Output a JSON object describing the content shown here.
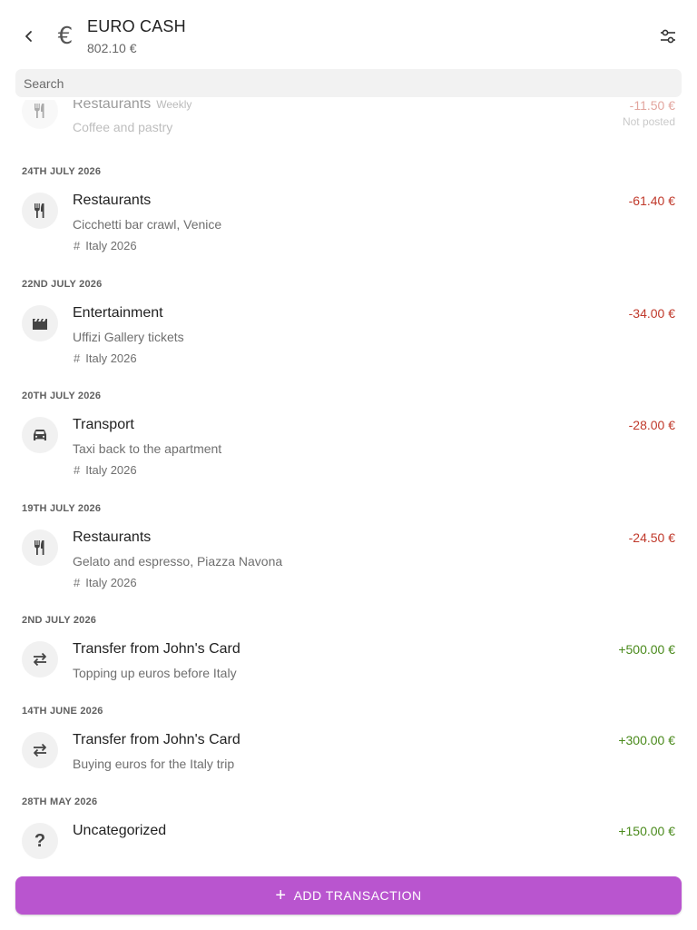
{
  "header": {
    "back_icon": "arrow-left-icon",
    "currency_icon": "euro-icon",
    "currency_symbol": "€",
    "title": "EURO CASH",
    "balance": "802.10 €",
    "filter_icon": "sliders-icon"
  },
  "search": {
    "placeholder": "Search",
    "value": ""
  },
  "partial_row": {
    "category": "Restaurants",
    "recurrence": "Weekly",
    "description": "Coffee and pastry",
    "amount": "-11.50 €",
    "status": "Not posted",
    "icon": "cutlery-icon"
  },
  "groups": [
    {
      "date": "24TH JULY 2026",
      "category": "Restaurants",
      "description": "Cicchetti bar crawl, Venice",
      "tag": "Italy 2026",
      "amount": "-61.40 €",
      "icon": "cutlery-icon"
    },
    {
      "date": "22ND JULY 2026",
      "category": "Entertainment",
      "description": "Uffizi Gallery tickets",
      "tag": "Italy 2026",
      "amount": "-34.00 €",
      "icon": "movie-clapper-icon"
    },
    {
      "date": "20TH JULY 2026",
      "category": "Transport",
      "description": "Taxi back to the apartment",
      "tag": "Italy 2026",
      "amount": "-28.00 €",
      "icon": "car-icon"
    },
    {
      "date": "19TH JULY 2026",
      "category": "Restaurants",
      "description": "Gelato and espresso, Piazza Navona",
      "tag": "Italy 2026",
      "amount": "-24.50 €",
      "icon": "cutlery-icon"
    },
    {
      "date": "2ND JULY 2026",
      "category": "Transfer from John's Card",
      "description": "Topping up euros before Italy",
      "amount": "+500.00 €",
      "icon": "transfer-icon"
    },
    {
      "date": "14TH JUNE 2026",
      "category": "Transfer from John's Card",
      "description": "Buying euros for the Italy trip",
      "amount": "+300.00 €",
      "icon": "transfer-icon"
    },
    {
      "date": "28TH MAY 2026",
      "category": "Uncategorized",
      "amount": "+150.00 €",
      "icon": "question-mark-icon"
    }
  ],
  "tag_symbol": "#",
  "question_symbol": "?",
  "add_button": {
    "label": "ADD TRANSACTION",
    "plus": "+"
  },
  "colors": {
    "negative": "#c0392b",
    "positive": "#4a8a1c",
    "accent": "#b955cf"
  }
}
